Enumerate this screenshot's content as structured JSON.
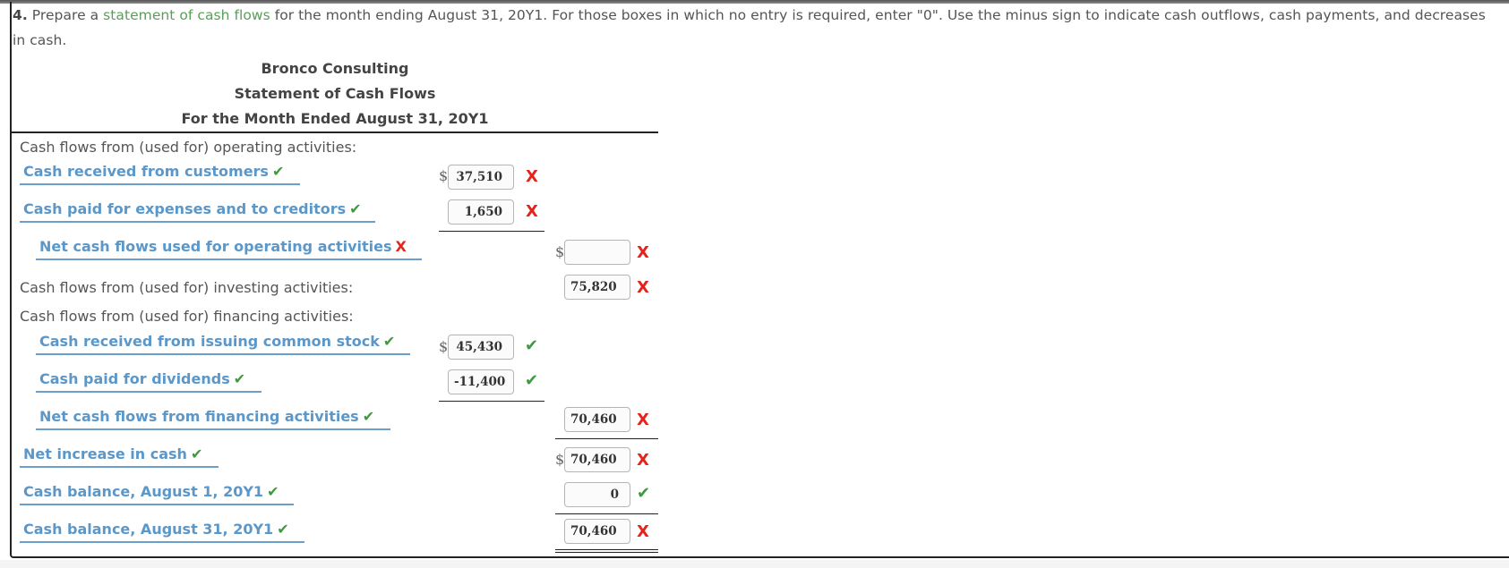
{
  "instructions": {
    "number": "4.",
    "prefix": " Prepare a ",
    "link_text": "statement of cash flows",
    "suffix": " for the month ending August 31, 20Y1. For those boxes in which no entry is required, enter \"0\". Use the minus sign to indicate cash outflows, cash payments, and decreases in cash."
  },
  "statement": {
    "company": "Bronco Consulting",
    "title": "Statement of Cash Flows",
    "period": "For the Month Ended August 31, 20Y1"
  },
  "labels": {
    "operating_header": "Cash flows from (used for) operating activities:",
    "investing_header": "Cash flows from (used for) investing activities:",
    "financing_header": "Cash flows from (used for) financing activities:"
  },
  "rows": {
    "cash_received_customers": {
      "label": "Cash received from customers",
      "label_status": "correct",
      "value": "37,510",
      "value_status": "incorrect",
      "currency": "$"
    },
    "cash_paid_expenses": {
      "label": "Cash paid for expenses and to creditors",
      "label_status": "correct",
      "value": "1,650",
      "value_status": "incorrect"
    },
    "net_operating": {
      "label": "Net cash flows used for operating activities",
      "label_status": "incorrect",
      "value": "",
      "value_status": "incorrect",
      "currency": "$"
    },
    "investing": {
      "value": "75,820",
      "value_status": "incorrect"
    },
    "cash_received_stock": {
      "label": "Cash received from issuing common stock",
      "label_status": "correct",
      "value": "45,430",
      "value_status": "correct",
      "currency": "$"
    },
    "cash_paid_dividends": {
      "label": "Cash paid for dividends",
      "label_status": "correct",
      "value": "-11,400",
      "value_status": "correct"
    },
    "net_financing": {
      "label": "Net cash flows from financing activities",
      "label_status": "correct",
      "value": "70,460",
      "value_status": "incorrect"
    },
    "net_increase": {
      "label": "Net increase in cash",
      "label_status": "correct",
      "value": "70,460",
      "value_status": "incorrect",
      "currency": "$"
    },
    "balance_aug1": {
      "label": "Cash balance, August 1, 20Y1",
      "label_status": "correct",
      "value": "0",
      "value_status": "correct"
    },
    "balance_aug31": {
      "label": "Cash balance, August 31, 20Y1",
      "label_status": "correct",
      "value": "70,460",
      "value_status": "incorrect"
    }
  },
  "icons": {
    "correct": "✔",
    "incorrect": "X"
  },
  "colors": {
    "link_green": "#5a9e5a",
    "dropdown_blue": "#5b97c9",
    "correct_green": "#3f9a3f",
    "incorrect_red": "#e6231a"
  }
}
